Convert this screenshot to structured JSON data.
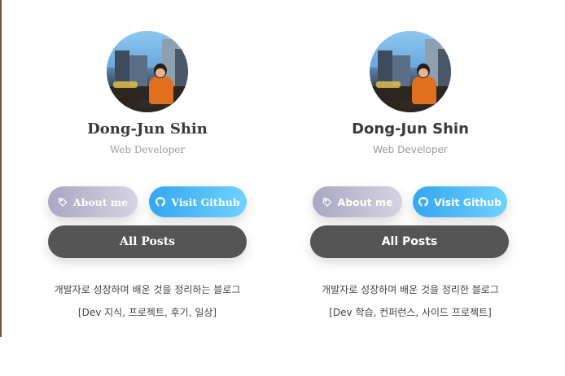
{
  "cards": [
    {
      "name": "Dong-Jun Shin",
      "role": "Web Developer",
      "about_label": "About me",
      "github_label": "Visit Github",
      "all_posts_label": "All Posts",
      "description": "개발자로 성장하며 배운 것을 정리하는 블로그",
      "tags": "[Dev 지식, 프로젝트, 후기, 일상]"
    },
    {
      "name": "Dong-Jun Shin",
      "role": "Web Developer",
      "about_label": "About me",
      "github_label": "Visit Github",
      "all_posts_label": "All Posts",
      "description": "개발자로 성장하며 배운 것을 정리한 블로그",
      "tags": "[Dev 학습, 컨퍼런스, 사이드 프로젝트]"
    }
  ],
  "icons": {
    "about": "tag-icon",
    "github": "github-icon"
  },
  "colors": {
    "about_gradient": [
      "#a9a7c2",
      "#d6d3e2"
    ],
    "github_gradient": [
      "#34a6f0",
      "#6fd2ff"
    ],
    "all_posts": "#555555"
  }
}
